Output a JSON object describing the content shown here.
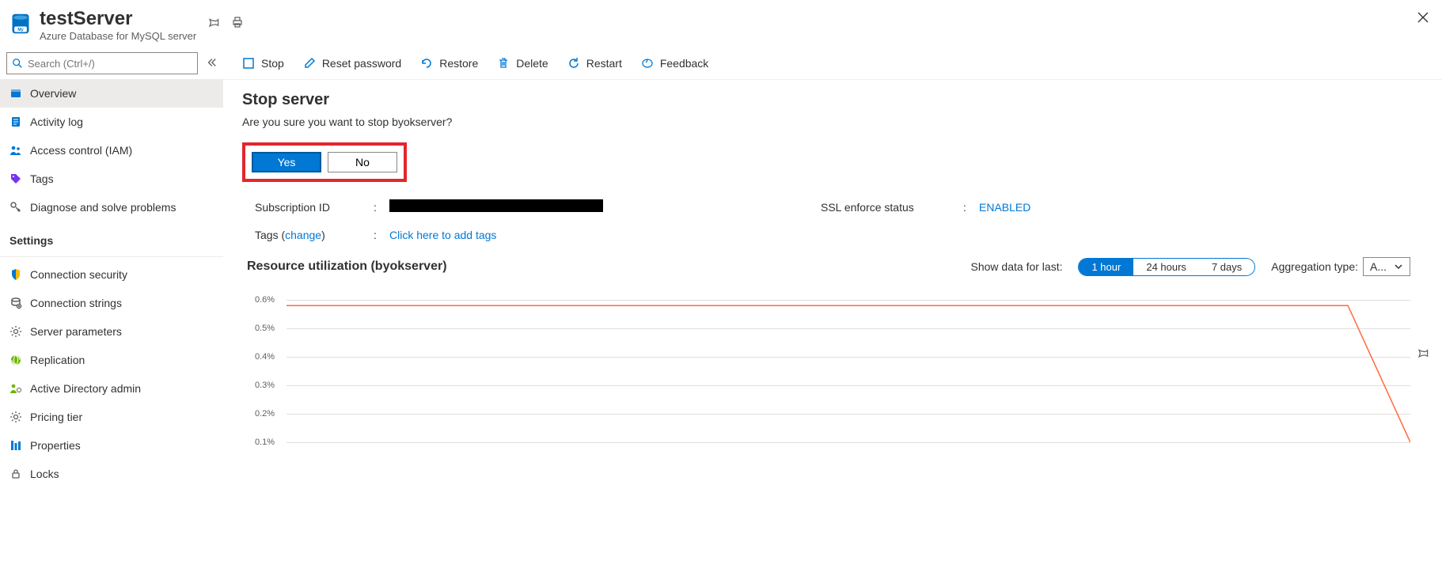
{
  "header": {
    "title": "testServer",
    "subtitle": "Azure Database for MySQL server"
  },
  "search": {
    "placeholder": "Search (Ctrl+/)"
  },
  "nav": {
    "overview": "Overview",
    "activity_log": "Activity log",
    "access_control": "Access control (IAM)",
    "tags": "Tags",
    "diagnose": "Diagnose and solve problems",
    "section_settings": "Settings",
    "connection_security": "Connection security",
    "connection_strings": "Connection strings",
    "server_parameters": "Server parameters",
    "replication": "Replication",
    "ad_admin": "Active Directory admin",
    "pricing_tier": "Pricing tier",
    "properties": "Properties",
    "locks": "Locks"
  },
  "toolbar": {
    "stop": "Stop",
    "reset_password": "Reset password",
    "restore": "Restore",
    "delete": "Delete",
    "restart": "Restart",
    "feedback": "Feedback"
  },
  "stop_panel": {
    "title": "Stop server",
    "message": "Are you sure you want to stop byokserver?",
    "yes": "Yes",
    "no": "No"
  },
  "details": {
    "subscription_id_label": "Subscription ID",
    "ssl_label": "SSL enforce status",
    "ssl_value": "ENABLED",
    "tags_label": "Tags",
    "tags_change": "change",
    "tags_value": "Click here to add tags"
  },
  "util": {
    "title": "Resource utilization (byokserver)",
    "show_label": "Show data for last:",
    "opt_1h": "1 hour",
    "opt_24h": "24 hours",
    "opt_7d": "7 days",
    "agg_label": "Aggregation type:",
    "agg_value": "A..."
  },
  "chart_data": {
    "type": "line",
    "title": "Resource utilization (byokserver)",
    "ylabel": "",
    "xlabel": "",
    "ylim": [
      0.1,
      0.6
    ],
    "y_ticks": [
      "0.6%",
      "0.5%",
      "0.4%",
      "0.3%",
      "0.2%",
      "0.1%"
    ],
    "series": [
      {
        "name": "utilization",
        "color": "#ff6a3c",
        "values": [
          0.58,
          0.58,
          0.58,
          0.58,
          0.58,
          0.58,
          0.58,
          0.58,
          0.58,
          0.58,
          0.58,
          0.58,
          0.58,
          0.58,
          0.58,
          0.58,
          0.58,
          0.58,
          0.1
        ]
      }
    ]
  }
}
